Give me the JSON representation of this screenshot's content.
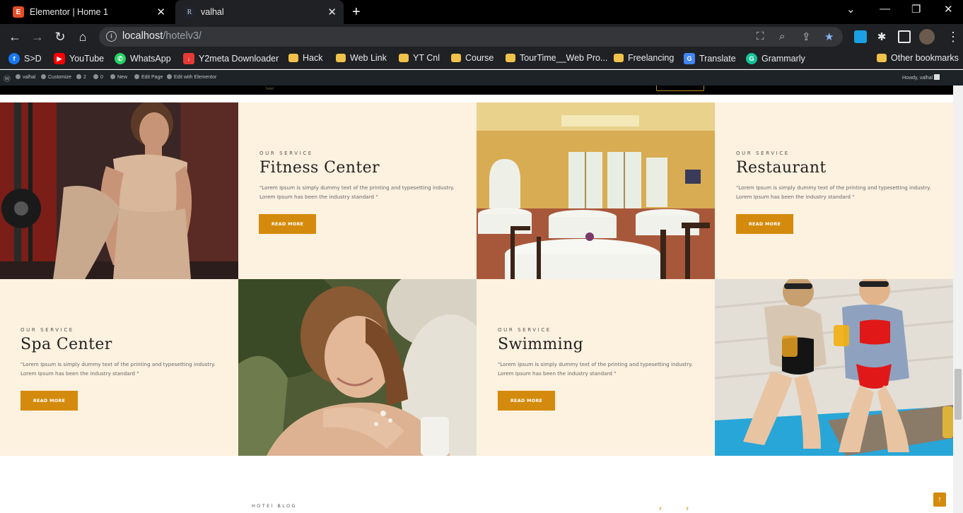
{
  "browser": {
    "tabs": [
      {
        "title": "Elementor | Home 1",
        "icon": "elementor-icon"
      },
      {
        "title": "valhal",
        "icon": "valhal-icon",
        "favicon_letter": "R"
      }
    ],
    "url_host": "localhost",
    "url_path": "/hotelv3/",
    "bookmarks": [
      {
        "label": "S>D",
        "icon": "facebook-icon",
        "color": "#1877f2"
      },
      {
        "label": "YouTube",
        "icon": "youtube-icon",
        "color": "#ff0000"
      },
      {
        "label": "WhatsApp",
        "icon": "whatsapp-icon",
        "color": "#25d366"
      },
      {
        "label": "Y2meta Downloader",
        "icon": "download-icon",
        "color": "#e53935"
      },
      {
        "label": "Hack",
        "icon": "folder-icon"
      },
      {
        "label": "Web Link",
        "icon": "folder-icon"
      },
      {
        "label": "YT Cnl",
        "icon": "folder-icon"
      },
      {
        "label": "Course",
        "icon": "folder-icon"
      },
      {
        "label": "TourTime__Web Pro...",
        "icon": "folder-icon"
      },
      {
        "label": "Freelancing",
        "icon": "folder-icon"
      },
      {
        "label": "Translate",
        "icon": "google-translate-icon",
        "color": "#4285f4"
      },
      {
        "label": "Grammarly",
        "icon": "grammarly-icon",
        "color": "#15c39a"
      }
    ],
    "other_bookmarks": "Other bookmarks"
  },
  "wp_admin_bar": {
    "site": "valhal",
    "customize": "Customize",
    "updates": "2",
    "comments": "0",
    "new": "New",
    "edit_page": "Edit Page",
    "edit_elementor": "Edit with Elementor",
    "howdy": "Howdy, valhal"
  },
  "site_header": {
    "logo_text": "hotel"
  },
  "services": [
    {
      "eyebrow": "OUR SERVICE",
      "title": "Fitness Center",
      "description": "\"Lorem Ipsum is simply dummy text of the printing and typesetting industry. Lorem Ipsum has been the industry standard \"",
      "button": "READ MORE",
      "image": "fitness-photo"
    },
    {
      "eyebrow": "OUR SERVICE",
      "title": "Restaurant",
      "description": "\"Lorem Ipsum is simply dummy text of the printing and typesetting industry. Lorem Ipsum has been the industry standard \"",
      "button": "READ MORE",
      "image": "restaurant-photo"
    },
    {
      "eyebrow": "OUR SERVICE",
      "title": "Spa Center",
      "description": "\"Lorem Ipsum is simply dummy text of the printing and typesetting industry. Lorem Ipsum has been the industry standard \"",
      "button": "READ MORE",
      "image": "spa-photo"
    },
    {
      "eyebrow": "OUR SERVICE",
      "title": "Swimming",
      "description": "\"Lorem Ipsum is simply dummy text of the printing and typesetting industry. Lorem Ipsum has been the industry standard \"",
      "button": "READ MORE",
      "image": "pool-photo"
    }
  ],
  "blog": {
    "eyebrow": "HOTEl BLOG"
  },
  "colors": {
    "accent": "#d48a0c",
    "service_bg": "#fdf1df",
    "chrome_dark": "#202124"
  }
}
